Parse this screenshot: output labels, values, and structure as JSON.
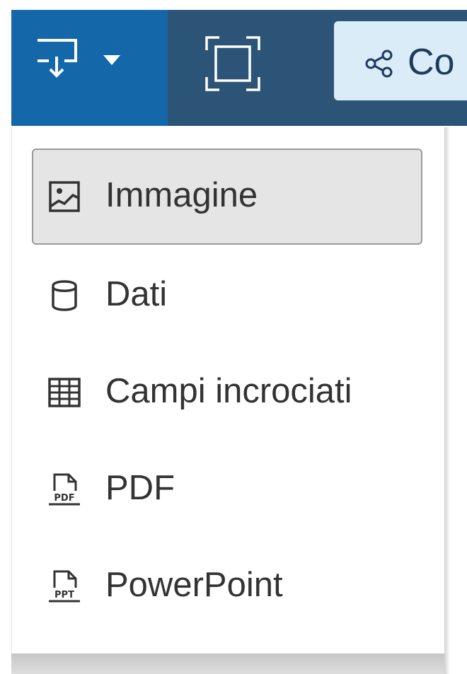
{
  "toolbar": {
    "download_button": {
      "icon": "download-icon",
      "caret_icon": "caret-down-icon"
    },
    "fullscreen_button": {
      "icon": "fullscreen-icon"
    },
    "share_button": {
      "icon": "share-icon",
      "label": "Co"
    },
    "colors": {
      "toolbar_bg": "#2c5476",
      "download_bg": "#1467a9",
      "share_bg": "#d9ecf8"
    }
  },
  "menu": {
    "items": [
      {
        "label": "Immagine",
        "icon": "image-icon",
        "selected": true
      },
      {
        "label": "Dati",
        "icon": "database-icon",
        "selected": false
      },
      {
        "label": "Campi incrociati",
        "icon": "crosstab-icon",
        "selected": false
      },
      {
        "label": "PDF",
        "icon": "pdf-file-icon",
        "selected": false
      },
      {
        "label": "PowerPoint",
        "icon": "powerpoint-file-icon",
        "selected": false
      }
    ]
  }
}
